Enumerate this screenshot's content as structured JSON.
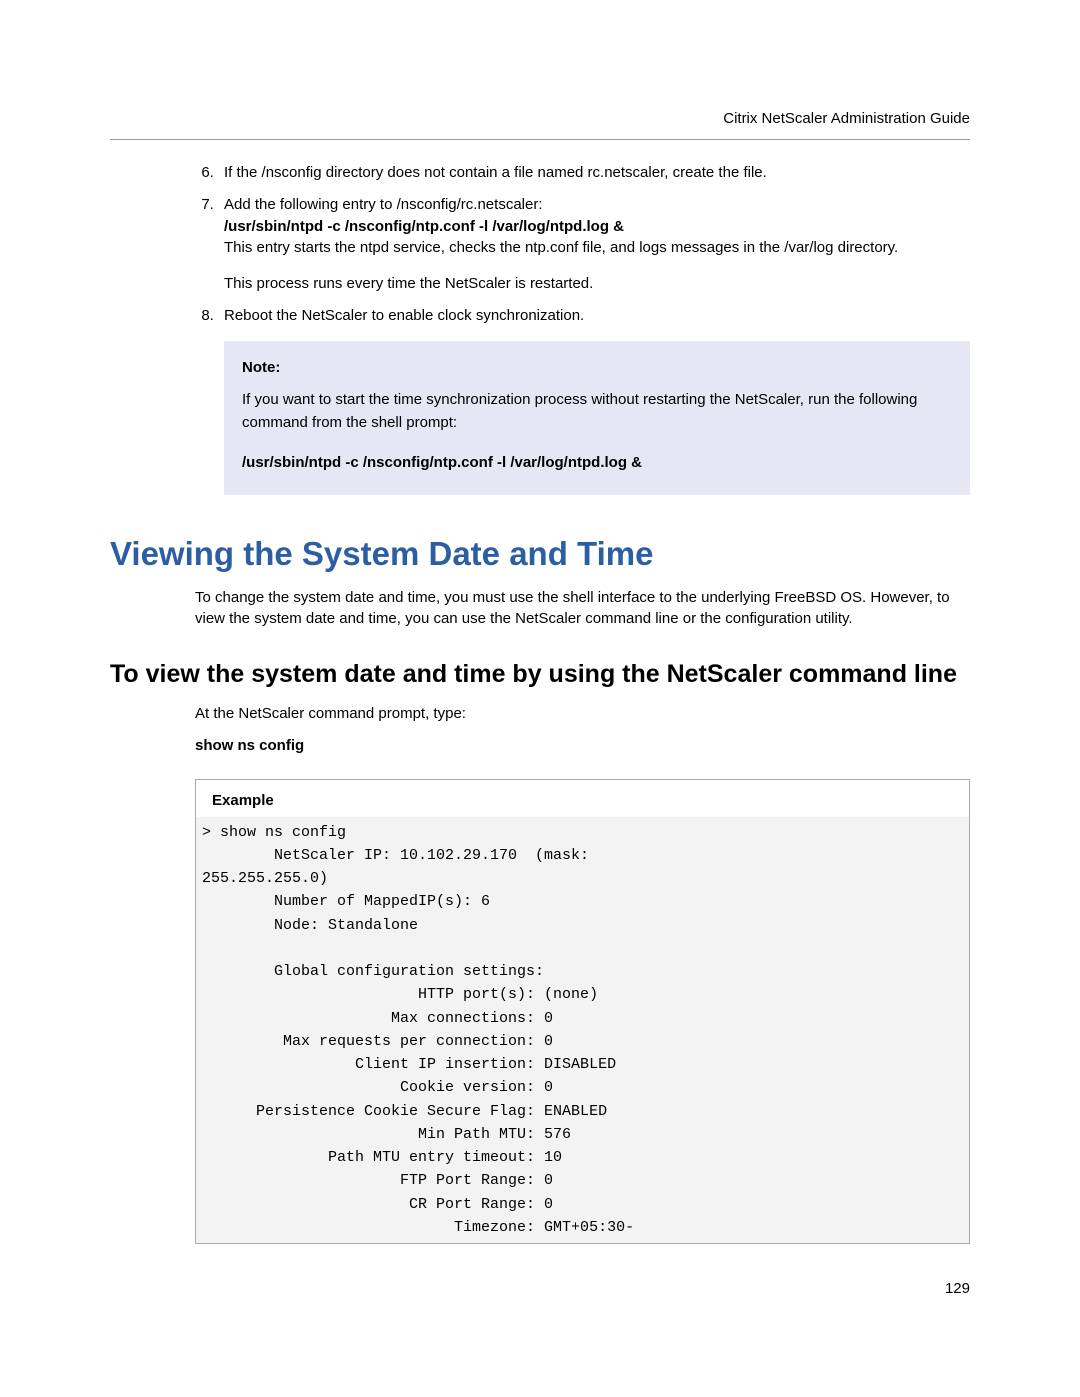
{
  "header": {
    "guide_title": "Citrix NetScaler Administration Guide"
  },
  "steps": {
    "start": "6",
    "item6": "If the /nsconfig directory does not contain a file named rc.netscaler, create the file.",
    "item7_intro": "Add the following entry to /nsconfig/rc.netscaler:",
    "item7_cmd": "/usr/sbin/ntpd -c /nsconfig/ntp.conf -l /var/log/ntpd.log &",
    "item7_desc": "This entry starts the ntpd service, checks the ntp.conf file, and logs messages in the /var/log directory.",
    "item7_note": "This process runs every time the NetScaler is restarted.",
    "item8": "Reboot the NetScaler to enable clock synchronization."
  },
  "note": {
    "label": "Note:",
    "body": "If you want to start the time synchronization process without restarting the NetScaler, run the following command from the shell prompt:",
    "cmd": "/usr/sbin/ntpd -c /nsconfig/ntp.conf -l /var/log/ntpd.log &"
  },
  "section": {
    "heading": "Viewing the System Date and Time",
    "intro": "To change the system date and time, you must use the shell interface to the underlying FreeBSD OS. However, to view the system date and time, you can use the NetScaler command line or the configuration utility."
  },
  "subsection": {
    "heading": "To view the system date and time by using the NetScaler command line",
    "prompt_text": "At the NetScaler command prompt, type:",
    "command": "show ns config"
  },
  "example": {
    "title": "Example",
    "text": "> show ns config\n        NetScaler IP: 10.102.29.170  (mask:\n255.255.255.0)\n        Number of MappedIP(s): 6\n        Node: Standalone\n\n        Global configuration settings:\n                        HTTP port(s): (none)\n                     Max connections: 0\n         Max requests per connection: 0\n                 Client IP insertion: DISABLED\n                      Cookie version: 0\n      Persistence Cookie Secure Flag: ENABLED\n                        Min Path MTU: 576\n              Path MTU entry timeout: 10\n                      FTP Port Range: 0\n                       CR Port Range: 0\n                            Timezone: GMT+05:30-"
  },
  "page_number": "129"
}
